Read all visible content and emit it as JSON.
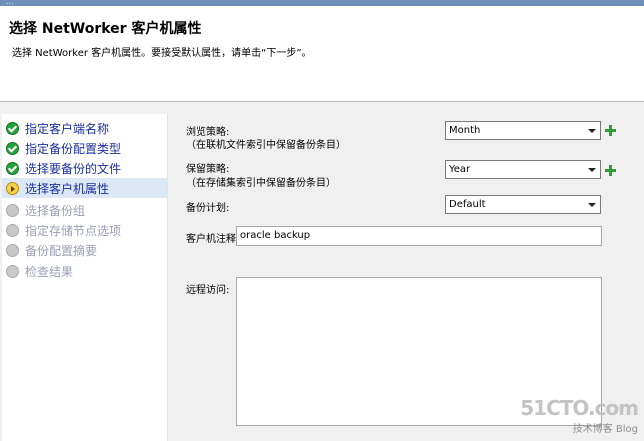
{
  "window": {
    "title": "..."
  },
  "header": {
    "title": "选择 NetWorker 客户机属性",
    "subtitle": "选择 NetWorker 客户机属性。要接受默认属性，请单击“下一步”。"
  },
  "steps": [
    {
      "label": "指定客户端名称",
      "state": "done"
    },
    {
      "label": "指定备份配置类型",
      "state": "done"
    },
    {
      "label": "选择要备份的文件",
      "state": "done"
    },
    {
      "label": "选择客户机属性",
      "state": "current"
    },
    {
      "label": "选择备份组",
      "state": "todo"
    },
    {
      "label": "指定存储节点选项",
      "state": "todo"
    },
    {
      "label": "备份配置摘要",
      "state": "todo"
    },
    {
      "label": "检查结果",
      "state": "todo"
    }
  ],
  "form": {
    "browse_policy_label": "浏览策略:",
    "browse_policy_note": "（在联机文件索引中保留备份条目）",
    "browse_policy_value": "Month",
    "retention_policy_label": "保留策略:",
    "retention_policy_note": "（在存储集索引中保留备份条目）",
    "retention_policy_value": "Year",
    "schedule_label": "备份计划:",
    "schedule_value": "Default",
    "comment_label": "客户机注释:",
    "comment_value": "oracle backup",
    "remote_access_label": "远程访问:",
    "remote_access_value": ""
  },
  "watermark": {
    "main": "51CTO.com",
    "sub": "技术博客 Blog"
  },
  "colors": {
    "done": "#26a23a",
    "current_bg": "#dde8f6",
    "link": "#1a2f9e",
    "add": "#2e9b36"
  }
}
